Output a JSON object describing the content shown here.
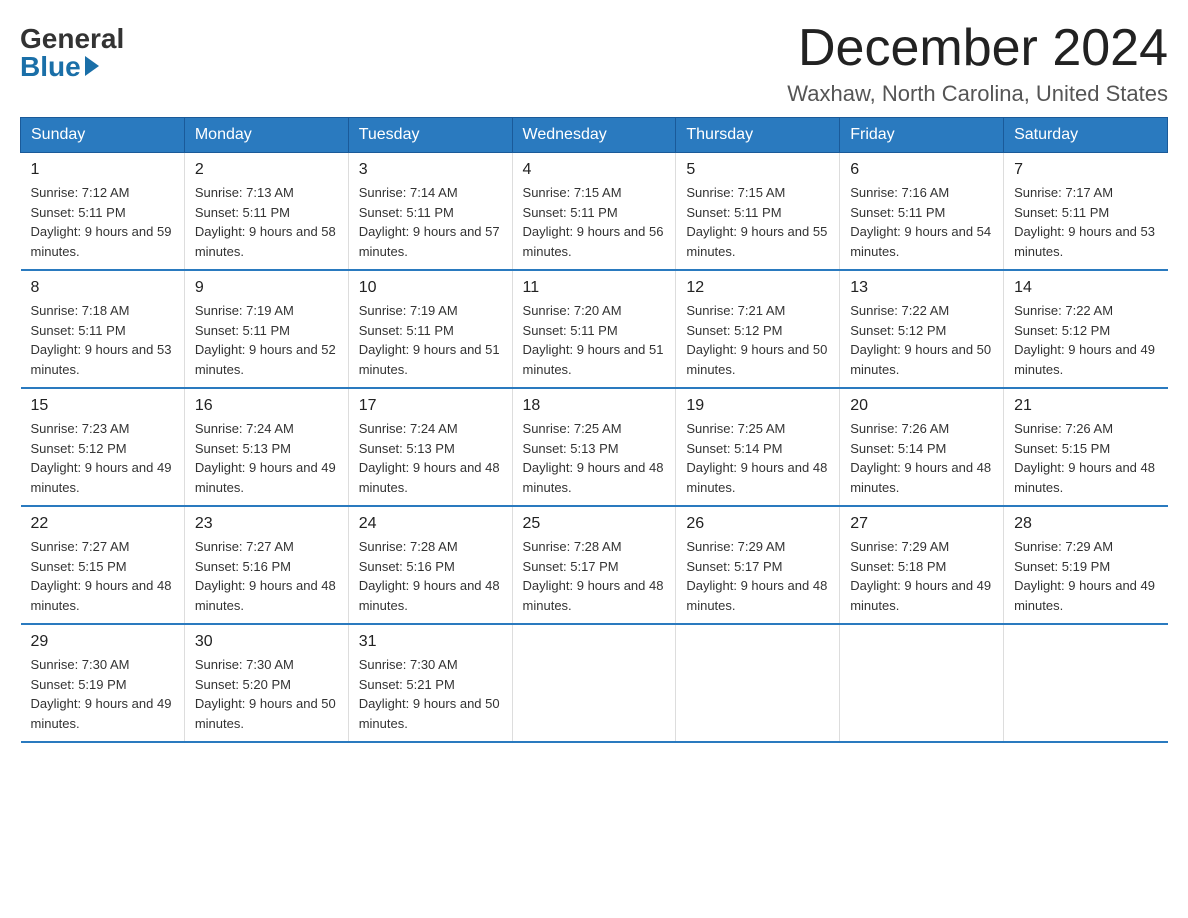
{
  "logo": {
    "general": "General",
    "blue": "Blue"
  },
  "header": {
    "month": "December 2024",
    "location": "Waxhaw, North Carolina, United States"
  },
  "weekdays": [
    "Sunday",
    "Monday",
    "Tuesday",
    "Wednesday",
    "Thursday",
    "Friday",
    "Saturday"
  ],
  "weeks": [
    [
      {
        "day": 1,
        "sunrise": "7:12 AM",
        "sunset": "5:11 PM",
        "daylight": "9 hours and 59 minutes."
      },
      {
        "day": 2,
        "sunrise": "7:13 AM",
        "sunset": "5:11 PM",
        "daylight": "9 hours and 58 minutes."
      },
      {
        "day": 3,
        "sunrise": "7:14 AM",
        "sunset": "5:11 PM",
        "daylight": "9 hours and 57 minutes."
      },
      {
        "day": 4,
        "sunrise": "7:15 AM",
        "sunset": "5:11 PM",
        "daylight": "9 hours and 56 minutes."
      },
      {
        "day": 5,
        "sunrise": "7:15 AM",
        "sunset": "5:11 PM",
        "daylight": "9 hours and 55 minutes."
      },
      {
        "day": 6,
        "sunrise": "7:16 AM",
        "sunset": "5:11 PM",
        "daylight": "9 hours and 54 minutes."
      },
      {
        "day": 7,
        "sunrise": "7:17 AM",
        "sunset": "5:11 PM",
        "daylight": "9 hours and 53 minutes."
      }
    ],
    [
      {
        "day": 8,
        "sunrise": "7:18 AM",
        "sunset": "5:11 PM",
        "daylight": "9 hours and 53 minutes."
      },
      {
        "day": 9,
        "sunrise": "7:19 AM",
        "sunset": "5:11 PM",
        "daylight": "9 hours and 52 minutes."
      },
      {
        "day": 10,
        "sunrise": "7:19 AM",
        "sunset": "5:11 PM",
        "daylight": "9 hours and 51 minutes."
      },
      {
        "day": 11,
        "sunrise": "7:20 AM",
        "sunset": "5:11 PM",
        "daylight": "9 hours and 51 minutes."
      },
      {
        "day": 12,
        "sunrise": "7:21 AM",
        "sunset": "5:12 PM",
        "daylight": "9 hours and 50 minutes."
      },
      {
        "day": 13,
        "sunrise": "7:22 AM",
        "sunset": "5:12 PM",
        "daylight": "9 hours and 50 minutes."
      },
      {
        "day": 14,
        "sunrise": "7:22 AM",
        "sunset": "5:12 PM",
        "daylight": "9 hours and 49 minutes."
      }
    ],
    [
      {
        "day": 15,
        "sunrise": "7:23 AM",
        "sunset": "5:12 PM",
        "daylight": "9 hours and 49 minutes."
      },
      {
        "day": 16,
        "sunrise": "7:24 AM",
        "sunset": "5:13 PM",
        "daylight": "9 hours and 49 minutes."
      },
      {
        "day": 17,
        "sunrise": "7:24 AM",
        "sunset": "5:13 PM",
        "daylight": "9 hours and 48 minutes."
      },
      {
        "day": 18,
        "sunrise": "7:25 AM",
        "sunset": "5:13 PM",
        "daylight": "9 hours and 48 minutes."
      },
      {
        "day": 19,
        "sunrise": "7:25 AM",
        "sunset": "5:14 PM",
        "daylight": "9 hours and 48 minutes."
      },
      {
        "day": 20,
        "sunrise": "7:26 AM",
        "sunset": "5:14 PM",
        "daylight": "9 hours and 48 minutes."
      },
      {
        "day": 21,
        "sunrise": "7:26 AM",
        "sunset": "5:15 PM",
        "daylight": "9 hours and 48 minutes."
      }
    ],
    [
      {
        "day": 22,
        "sunrise": "7:27 AM",
        "sunset": "5:15 PM",
        "daylight": "9 hours and 48 minutes."
      },
      {
        "day": 23,
        "sunrise": "7:27 AM",
        "sunset": "5:16 PM",
        "daylight": "9 hours and 48 minutes."
      },
      {
        "day": 24,
        "sunrise": "7:28 AM",
        "sunset": "5:16 PM",
        "daylight": "9 hours and 48 minutes."
      },
      {
        "day": 25,
        "sunrise": "7:28 AM",
        "sunset": "5:17 PM",
        "daylight": "9 hours and 48 minutes."
      },
      {
        "day": 26,
        "sunrise": "7:29 AM",
        "sunset": "5:17 PM",
        "daylight": "9 hours and 48 minutes."
      },
      {
        "day": 27,
        "sunrise": "7:29 AM",
        "sunset": "5:18 PM",
        "daylight": "9 hours and 49 minutes."
      },
      {
        "day": 28,
        "sunrise": "7:29 AM",
        "sunset": "5:19 PM",
        "daylight": "9 hours and 49 minutes."
      }
    ],
    [
      {
        "day": 29,
        "sunrise": "7:30 AM",
        "sunset": "5:19 PM",
        "daylight": "9 hours and 49 minutes."
      },
      {
        "day": 30,
        "sunrise": "7:30 AM",
        "sunset": "5:20 PM",
        "daylight": "9 hours and 50 minutes."
      },
      {
        "day": 31,
        "sunrise": "7:30 AM",
        "sunset": "5:21 PM",
        "daylight": "9 hours and 50 minutes."
      },
      null,
      null,
      null,
      null
    ]
  ]
}
